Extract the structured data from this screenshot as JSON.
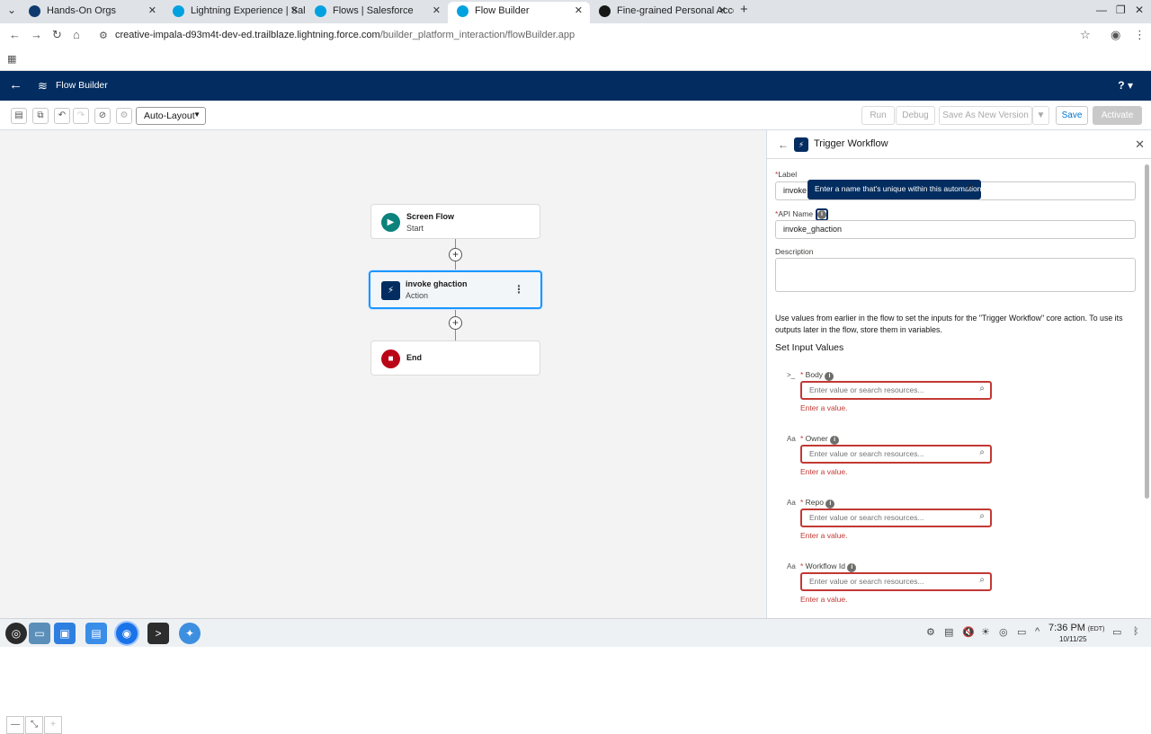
{
  "browser": {
    "tabs": [
      {
        "label": "Hands-On Orgs",
        "color": "#0f3a6e"
      },
      {
        "label": "Lightning Experience | Sale",
        "color": "#00a1e0"
      },
      {
        "label": "Flows | Salesforce",
        "color": "#00a1e0"
      },
      {
        "label": "Flow Builder",
        "color": "#00a1e0"
      },
      {
        "label": "Fine-grained Personal Acce",
        "color": "#181717"
      }
    ],
    "url_host": "creative-impala-d93m4t-dev-ed.trailblaze.lightning.force.com",
    "url_path": "/builder_platform_interaction/flowBuilder.app"
  },
  "app": {
    "title": "Flow Builder",
    "help_label": "?"
  },
  "toolbar": {
    "layout_select": "Auto-Layout",
    "run": "Run",
    "debug": "Debug",
    "save_as_new": "Save As New Version",
    "save": "Save",
    "activate": "Activate"
  },
  "canvas": {
    "nodes": [
      {
        "title": "Screen Flow",
        "subtitle": "Start",
        "color": "#0b827c"
      },
      {
        "title": "invoke ghaction",
        "subtitle": "Action"
      },
      {
        "title": "End",
        "subtitle": "",
        "color": "#ba0517"
      }
    ]
  },
  "panel": {
    "title": "Trigger Workflow",
    "label_label": "Label",
    "label_value": "invoke",
    "tooltip": "Enter a name that's unique within this automation.",
    "api_name_label": "API Name",
    "api_name_value": "invoke_ghaction",
    "description_label": "Description",
    "help_text": "Use values from earlier in the flow to set the inputs for the \"Trigger Workflow\" core action. To use its outputs later in the flow, store them in variables.",
    "section_title": "Set Input Values",
    "placeholder": "Enter value or search resources...",
    "error_text": "Enter a value.",
    "params": [
      {
        "name": "Body",
        "type_icon": ">_"
      },
      {
        "name": "Owner",
        "type_icon": "Aa"
      },
      {
        "name": "Repo",
        "type_icon": "Aa"
      },
      {
        "name": "Workflow Id",
        "type_icon": "Aa"
      }
    ]
  },
  "taskbar": {
    "time": "7:36 PM",
    "tz": "(EDT)",
    "date": "10/11/25"
  }
}
